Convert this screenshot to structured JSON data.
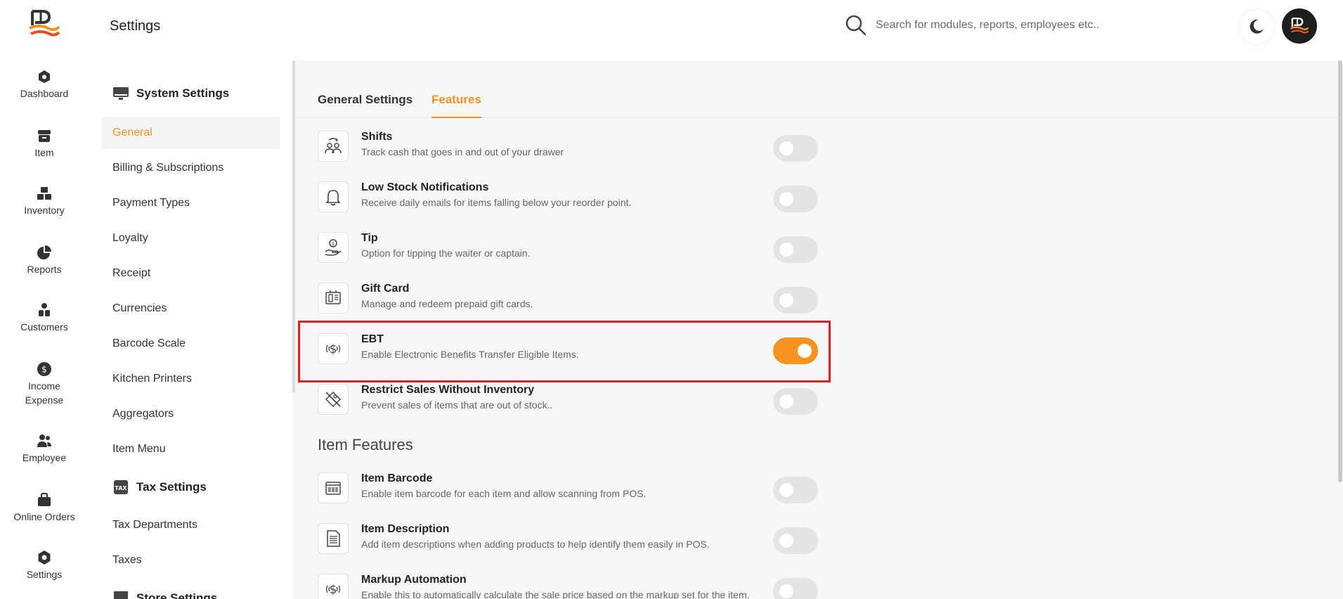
{
  "rail": {
    "items": [
      {
        "label": "Dashboard",
        "icon": "dashboard-icon"
      },
      {
        "label": "Item",
        "icon": "item-icon"
      },
      {
        "label": "Inventory",
        "icon": "inventory-icon"
      },
      {
        "label": "Reports",
        "icon": "reports-icon"
      },
      {
        "label": "Customers",
        "icon": "customers-icon"
      },
      {
        "label": "Income",
        "label2": "Expense",
        "icon": "income-expense-icon"
      },
      {
        "label": "Employee",
        "icon": "employee-icon"
      },
      {
        "label": "Online Orders",
        "icon": "online-orders-icon"
      },
      {
        "label": "Settings",
        "icon": "settings-icon"
      }
    ]
  },
  "header": {
    "title": "Settings",
    "search_placeholder": "Search for modules, reports, employees etc.."
  },
  "menu": {
    "system_heading": "System Settings",
    "system_items": [
      "General",
      "Billing & Subscriptions",
      "Payment Types",
      "Loyalty",
      "Receipt",
      "Currencies",
      "Barcode Scale",
      "Kitchen Printers",
      "Aggregators",
      "Item Menu"
    ],
    "tax_heading": "Tax Settings",
    "tax_items": [
      "Tax Departments",
      "Taxes"
    ],
    "store_heading": "Store Settings",
    "active_item": "General"
  },
  "tabs": [
    {
      "label": "General Settings",
      "active": false
    },
    {
      "label": "Features",
      "active": true
    }
  ],
  "features": [
    {
      "title": "Shifts",
      "desc": "Track cash that goes in and out of your drawer",
      "icon": "shifts-icon",
      "on": false
    },
    {
      "title": "Low Stock Notifications",
      "desc": "Receive daily emails for items falling below your reorder point.",
      "icon": "bell-icon",
      "on": false
    },
    {
      "title": "Tip",
      "desc": "Option for tipping the waiter or captain.",
      "icon": "tip-icon",
      "on": false
    },
    {
      "title": "Gift Card",
      "desc": "Manage and redeem prepaid gift cards.",
      "icon": "gift-card-icon",
      "on": false
    },
    {
      "title": "EBT",
      "desc": "Enable Electronic Benefits Transfer Eligible Items.",
      "icon": "ebt-icon",
      "on": true
    },
    {
      "title": "Restrict Sales Without Inventory",
      "desc": "Prevent sales of items that are out of stock..",
      "icon": "restrict-icon",
      "on": false
    }
  ],
  "item_features_heading": "Item Features",
  "item_features": [
    {
      "title": "Item Barcode",
      "desc": "Enable item barcode for each item and allow scanning from POS.",
      "icon": "barcode-icon",
      "on": false
    },
    {
      "title": "Item Description",
      "desc": "Add item descriptions when adding products to help identify them easily in POS.",
      "icon": "description-icon",
      "on": false
    },
    {
      "title": "Markup Automation",
      "desc": "Enable this to automatically calculate the sale price based on the markup set for the item.",
      "icon": "markup-icon",
      "on": false
    }
  ],
  "colors": {
    "accent": "#f7931e",
    "highlight": "#e02020"
  }
}
